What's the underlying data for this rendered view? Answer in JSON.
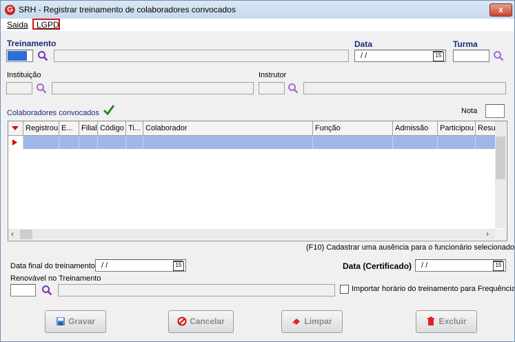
{
  "window": {
    "title": "SRH - Registrar treinamento de colaboradores convocados",
    "app_icon": "G",
    "close_label": "x"
  },
  "menu": {
    "saida": "Saida",
    "lgpd": "LGPD"
  },
  "form": {
    "treinamento_label": "Treinamento",
    "data_label": "Data",
    "data_value": "/ /",
    "turma_label": "Turma",
    "instituicao_label": "Instituição",
    "instrutor_label": "Instrutor",
    "colaboradores_label": "Colaboradores convocados",
    "nota_label": "Nota",
    "calendar_day": "15"
  },
  "grid": {
    "columns": [
      "Registrou",
      "E...",
      "Filial",
      "Código",
      "Ti...",
      "Colaborador",
      "Função",
      "Admissão",
      "Participou",
      "Resu"
    ],
    "rows": [
      [
        "",
        "",
        "",
        "",
        "",
        "",
        "",
        "",
        "",
        ""
      ]
    ]
  },
  "hint": "(F10) Cadastrar uma ausência para o funcionário selecionado",
  "bottom": {
    "data_final_label": "Data final do treinamento",
    "data_final_value": "/ /",
    "data_cert_label": "Data (Certificado)",
    "data_cert_value": "/ /",
    "renovavel_label": "Renovável no Treinamento",
    "importar_label": "Importar horário do treinamento para Frequência"
  },
  "buttons": {
    "gravar": "Gravar",
    "cancelar": "Cancelar",
    "limpar": "Limpar",
    "excluir": "Excluir"
  },
  "colors": {
    "accent": "#1a2a7a",
    "selection": "#2d6fd6",
    "row_selected": "#9fb8e8",
    "highlight_box": "#e01010"
  }
}
